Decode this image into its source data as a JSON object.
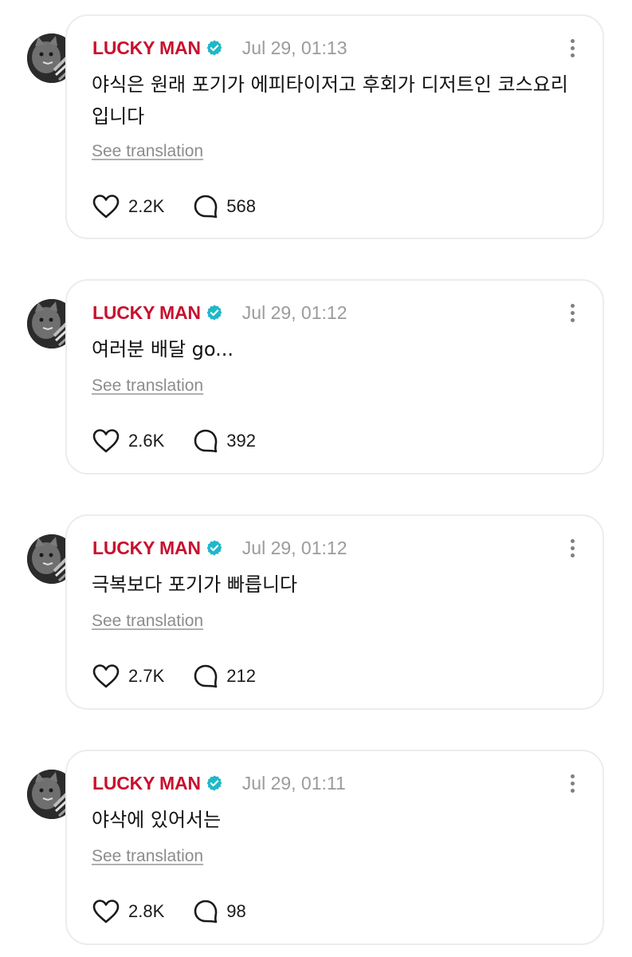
{
  "posts": [
    {
      "author": "LUCKY MAN",
      "verified": true,
      "timestamp": "Jul 29, 01:13",
      "text": "야식은 원래 포기가 에피타이저고 후회가 디저트인 코스요리 입니다",
      "translate_label": "See translation",
      "likes": "2.2K",
      "replies": "568"
    },
    {
      "author": "LUCKY MAN",
      "verified": true,
      "timestamp": "Jul 29, 01:12",
      "text": "여러분 배달 go...",
      "translate_label": "See translation",
      "likes": "2.6K",
      "replies": "392"
    },
    {
      "author": "LUCKY MAN",
      "verified": true,
      "timestamp": "Jul 29, 01:12",
      "text": "극복보다 포기가 빠릅니다",
      "translate_label": "See translation",
      "likes": "2.7K",
      "replies": "212"
    },
    {
      "author": "LUCKY MAN",
      "verified": true,
      "timestamp": "Jul 29, 01:11",
      "text": "야삭에 있어서는",
      "translate_label": "See translation",
      "likes": "2.8K",
      "replies": "98"
    }
  ],
  "icons": {
    "verified_badge": "verified-badge-icon",
    "more": "more-vertical-icon",
    "like": "heart-icon",
    "reply": "speech-bubble-icon"
  },
  "colors": {
    "author_name": "#c8102e",
    "verified_badge": "#1fb8c8",
    "timestamp": "#9b9b9b",
    "translate_link": "#8c8c8c",
    "card_border": "#ececec"
  }
}
